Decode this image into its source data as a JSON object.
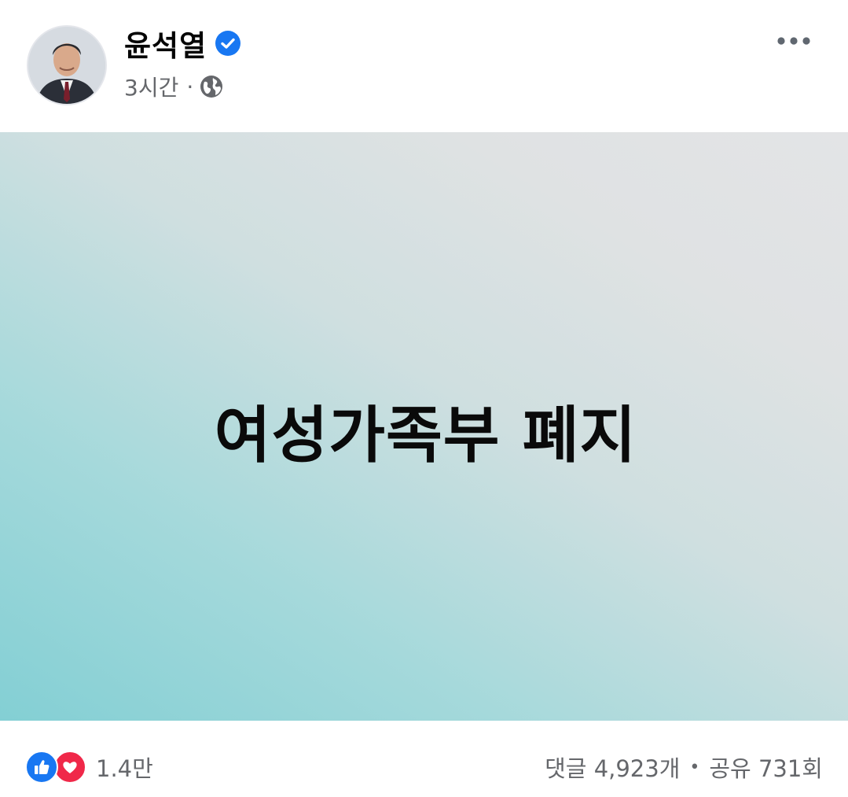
{
  "post": {
    "author": {
      "name": "윤석열",
      "verified": true,
      "avatar": "profile-photo"
    },
    "timestamp": "3시간",
    "meta_separator": "·",
    "audience_icon": "globe-icon",
    "more_icon": "more-options-icon",
    "text": "여성가족부 폐지",
    "background": {
      "colors": [
        "#83cfd4",
        "#a5d9db",
        "#cfdfe0",
        "#e3e4e6"
      ]
    }
  },
  "footer": {
    "reaction_icons": [
      "like-icon",
      "love-icon"
    ],
    "reaction_count": "1.4만",
    "comments": "댓글 4,923개",
    "separator": "•",
    "shares": "공유 731회"
  },
  "colors": {
    "verified_blue": "#1877f2",
    "like_blue": "#1877f2",
    "love_red": "#f02849",
    "secondary_text": "#65676b"
  }
}
